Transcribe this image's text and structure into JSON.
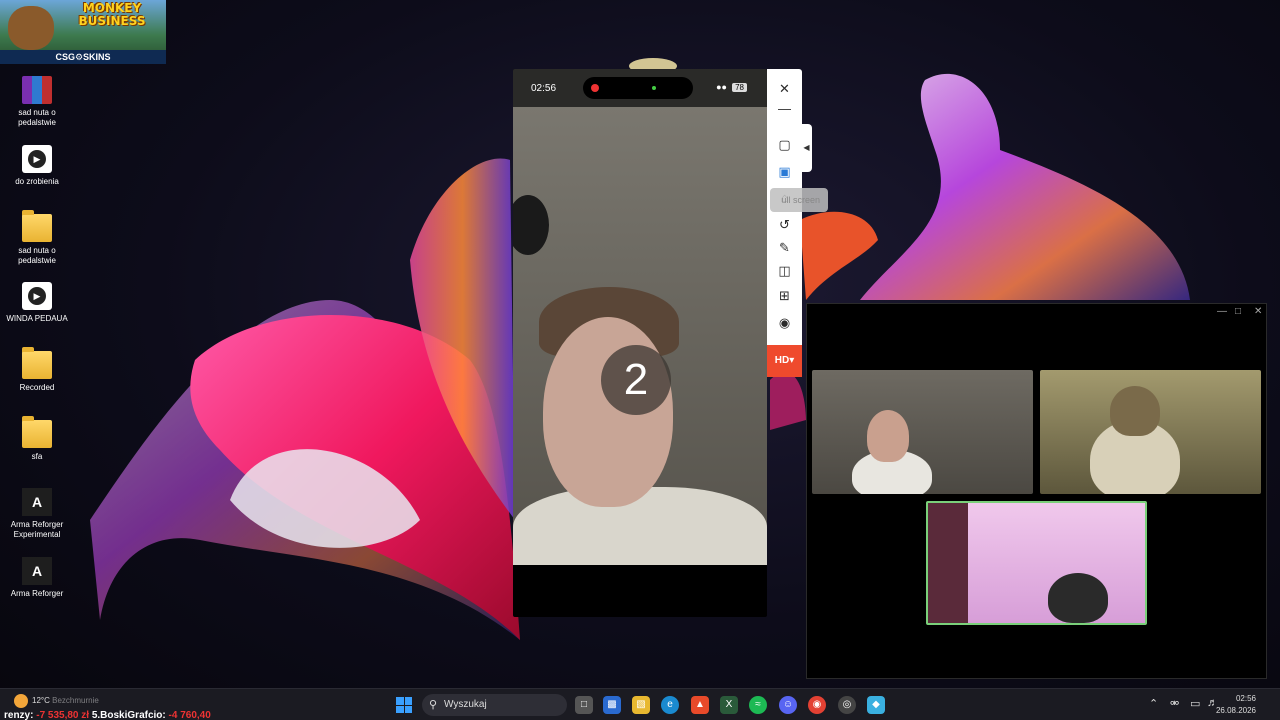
{
  "ad": {
    "title": "MONKEY BUSINESS",
    "footer": "CSG⚙SKINS"
  },
  "desktop_icons": [
    {
      "label": "sad nuta o pedalstwie",
      "icon": "winrar-archive-icon"
    },
    {
      "label": "do zrobienia",
      "icon": "media-file-icon"
    },
    {
      "label": "sad nuta o pedalstwie",
      "icon": "folder-icon"
    },
    {
      "label": "WINDA PEDAUA",
      "icon": "media-file-icon"
    },
    {
      "label": "Recorded",
      "icon": "folder-icon"
    },
    {
      "label": "sfa",
      "icon": "folder-icon"
    },
    {
      "label": "Arma Reforger Experimental",
      "icon": "arma-shortcut-icon"
    },
    {
      "label": "Arma Reforger",
      "icon": "arma-shortcut-icon"
    }
  ],
  "phone": {
    "time": "02:56",
    "battery": "78",
    "countdown": "2"
  },
  "toolbar": {
    "close": "✕",
    "minimize": "—",
    "tooltip": "ull screen",
    "hd_label": "HD▾"
  },
  "taskbar": {
    "weather_temp": "12°C",
    "weather_text": "Bezchmurnie",
    "ticker_prefix": "renzy:",
    "ticker_value1": "-7 535,80 zł",
    "ticker_name": "5.BoskiGrafcio:",
    "ticker_value2": "-4 760,40",
    "search_placeholder": "Wyszukaj",
    "time": "02:56",
    "date": "26.08.2026"
  },
  "colors": {
    "accent_red": "#ef4a2d",
    "windows_blue": "#3aa0ff",
    "active_speaker_border": "#7ad07a"
  }
}
